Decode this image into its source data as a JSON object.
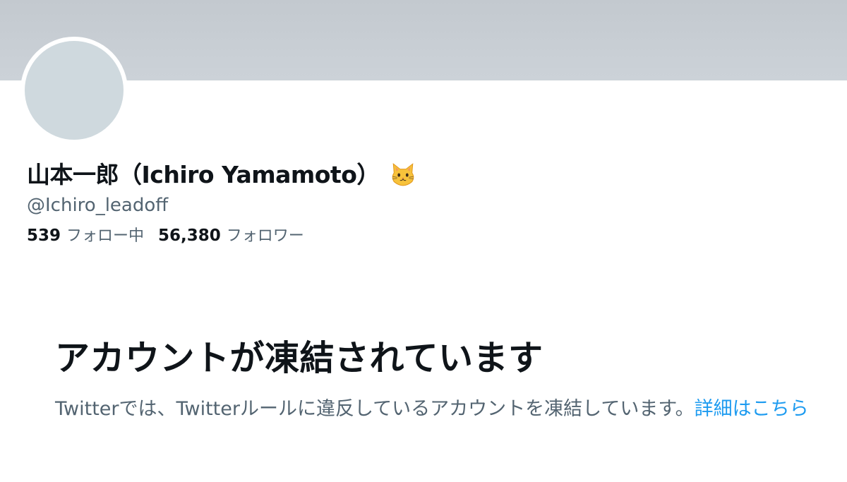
{
  "profile": {
    "display_name": "山本一郎（Ichiro Yamamoto）",
    "name_emoji_icon": "cat-face-icon",
    "handle": "@Ichiro_leadoff",
    "following": {
      "count": "539",
      "label": "フォロー中"
    },
    "followers": {
      "count": "56,380",
      "label": "フォロワー"
    }
  },
  "suspension": {
    "heading": "アカウントが凍結されています",
    "message": "Twitterでは、Twitterルールに違反しているアカウントを凍結しています。",
    "link_label": "詳細はこちら"
  },
  "colors": {
    "banner": "#c8ced4",
    "avatar": "#cfd9de",
    "text_primary": "#0f1419",
    "text_secondary": "#536471",
    "link": "#1d9bf0"
  }
}
